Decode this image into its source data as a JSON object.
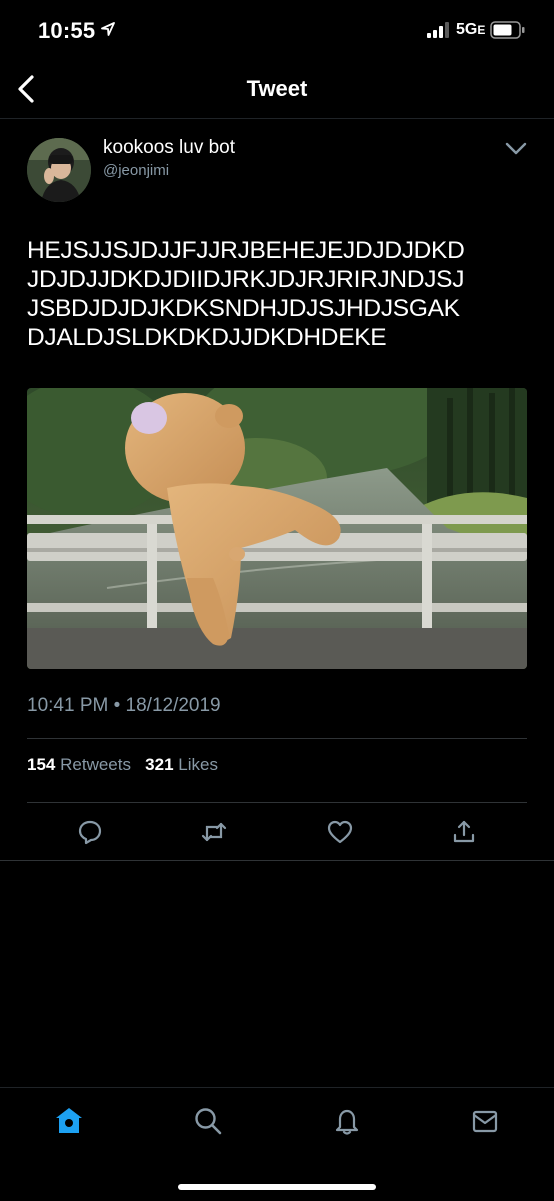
{
  "status_bar": {
    "time": "10:55",
    "network": "5G",
    "network_sub": "E"
  },
  "nav": {
    "title": "Tweet"
  },
  "author": {
    "display_name": "kookoos luv bot",
    "handle": "@jeonjimi"
  },
  "tweet": {
    "text_lines": [
      "HEJSJJSJDJJFJJRJBEHEJEJDJDJDKD",
      "JDJDJJDKDJDIIDJRKJDJRJRIRJNDJSJ",
      "JSBDJDJDJKDKSNDHJDJSJHDJSGAK",
      "DJALDJSLDKDKDJJDKDHDEKE"
    ],
    "timestamp": "10:41 PM • 18/12/2019",
    "retweets_count": "154",
    "retweets_label": "Retweets",
    "likes_count": "321",
    "likes_label": "Likes"
  },
  "icons": {
    "back": "back-chevron-icon",
    "more": "chevron-down-icon",
    "reply": "reply-icon",
    "retweet": "retweet-icon",
    "like": "heart-icon",
    "share": "share-icon",
    "home": "home-icon",
    "search": "search-icon",
    "notifications": "bell-icon",
    "messages": "envelope-icon"
  },
  "colors": {
    "background": "#000000",
    "text": "#ffffff",
    "secondary_text": "#8899a6",
    "accent": "#1da1f2",
    "divider": "#2f3336"
  }
}
